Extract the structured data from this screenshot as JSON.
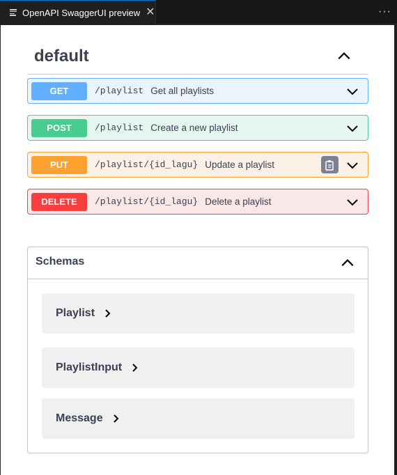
{
  "tab": {
    "title": "OpenAPI SwaggerUI preview",
    "close": "✕",
    "more": "···"
  },
  "section": {
    "title": "default"
  },
  "operations": [
    {
      "method": "GET",
      "path": "/playlist",
      "summary": "Get all playlists"
    },
    {
      "method": "POST",
      "path": "/playlist",
      "summary": "Create a new playlist"
    },
    {
      "method": "PUT",
      "path": "/playlist/{id_lagu}",
      "summary": "Update a playlist"
    },
    {
      "method": "DELETE",
      "path": "/playlist/{id_lagu}",
      "summary": "Delete a playlist"
    }
  ],
  "schemas": {
    "title": "Schemas",
    "models": [
      "Playlist",
      "PlaylistInput",
      "Message"
    ]
  },
  "colors": {
    "get": "#61affe",
    "post": "#49cc90",
    "put": "#fca130",
    "delete": "#f93e3e"
  }
}
